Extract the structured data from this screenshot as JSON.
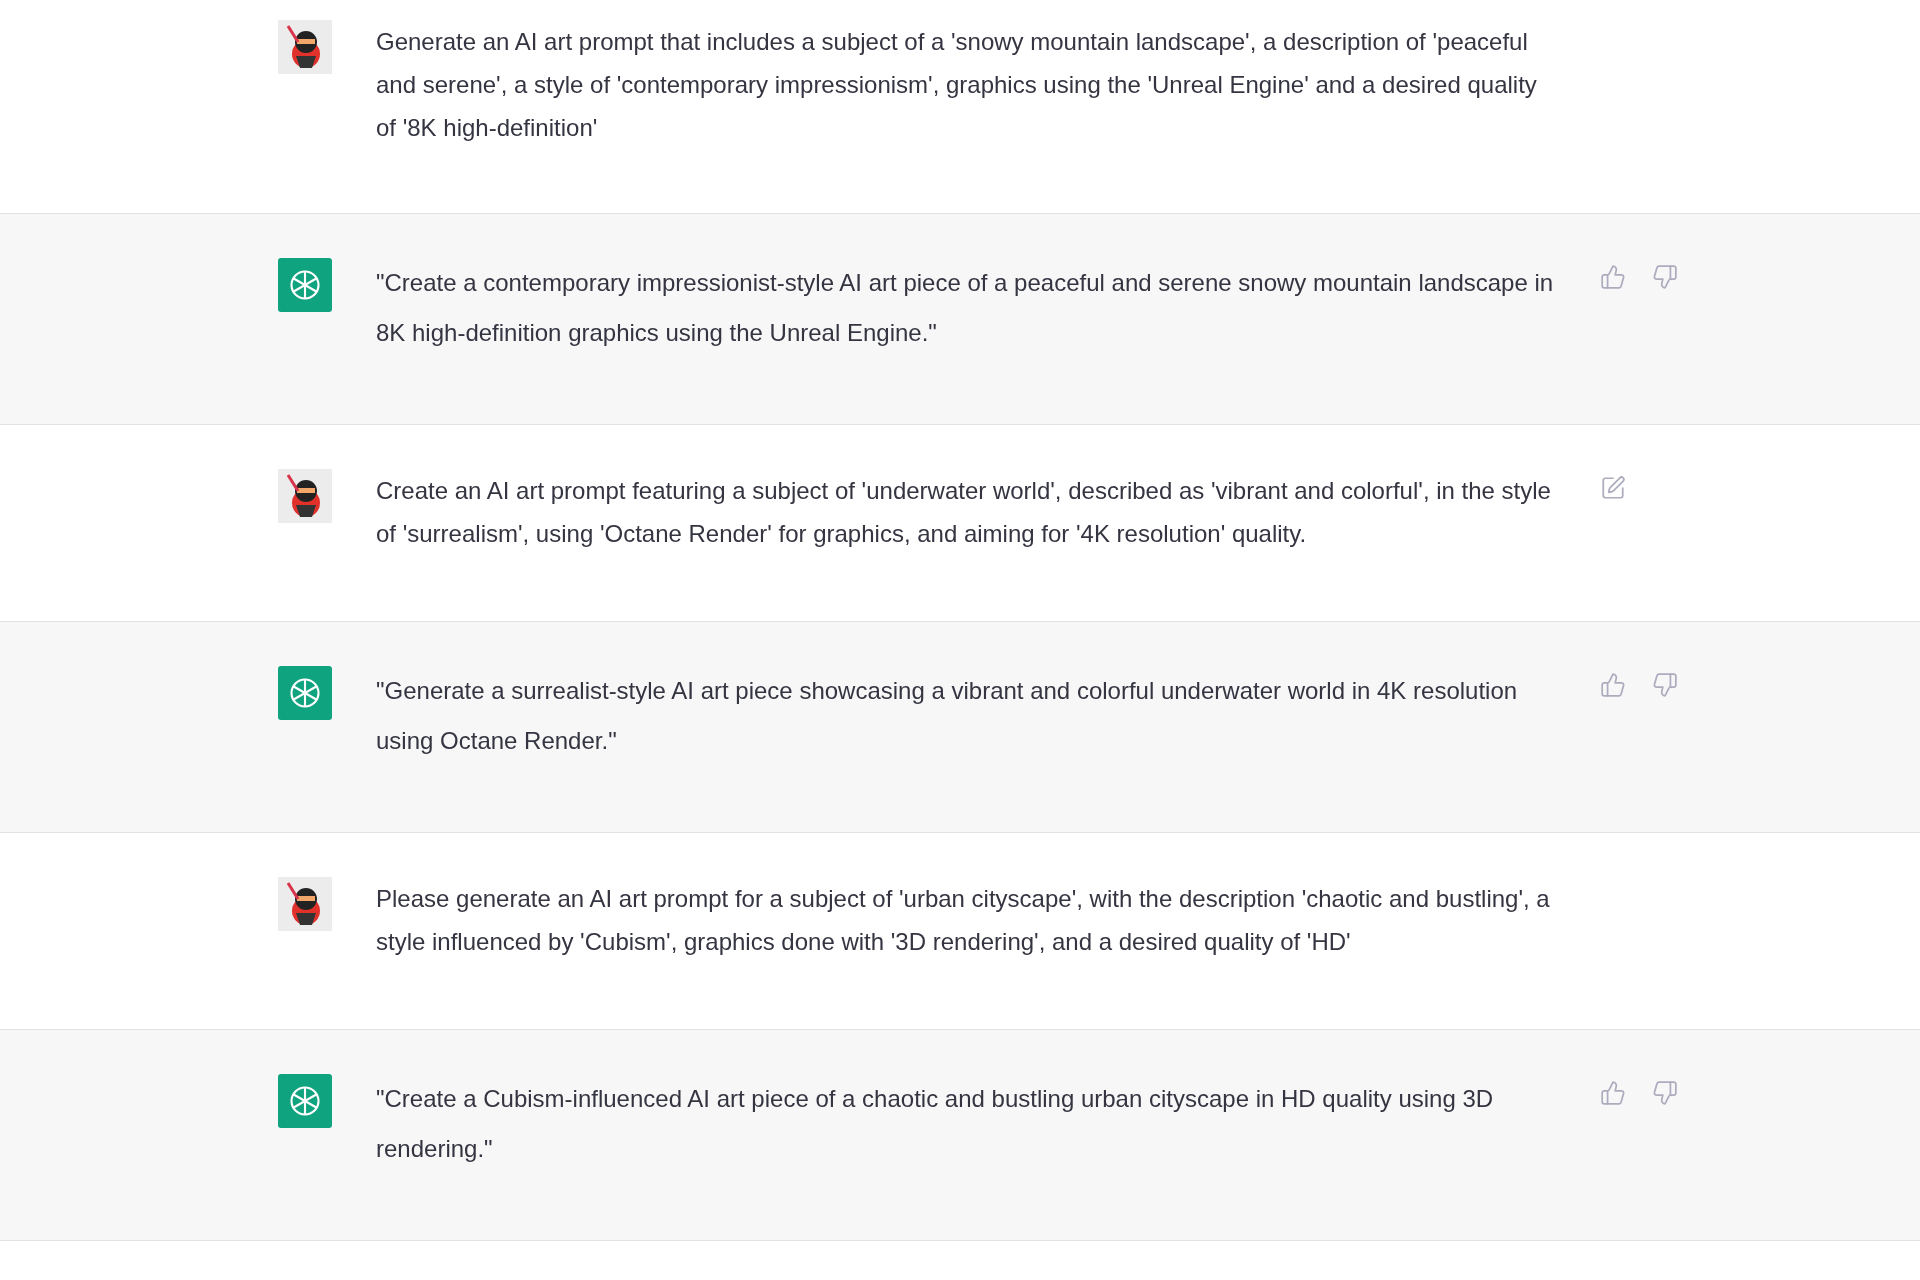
{
  "messages": [
    {
      "kind": "user",
      "edit_icon": false,
      "text": "Generate an AI art prompt that includes a subject of a 'snowy mountain landscape', a description of 'peaceful and serene', a style of 'contemporary impressionism', graphics using the 'Unreal Engine' and a desired quality of '8K high-definition'"
    },
    {
      "kind": "assistant",
      "text": "\"Create a contemporary impressionist-style AI art piece of a peaceful and serene snowy mountain landscape in 8K high-definition graphics using the Unreal Engine.\""
    },
    {
      "kind": "user",
      "edit_icon": true,
      "text": "Create an AI art prompt featuring a subject of 'underwater world', described as 'vibrant and colorful', in the style of 'surrealism', using 'Octane Render' for graphics, and aiming for '4K resolution' quality."
    },
    {
      "kind": "assistant",
      "text": "\"Generate a surrealist-style AI art piece showcasing a vibrant and colorful underwater world in 4K resolution using Octane Render.\""
    },
    {
      "kind": "user",
      "edit_icon": false,
      "text": "Please generate an AI art prompt for a subject of 'urban cityscape', with the description 'chaotic and bustling', a style influenced by 'Cubism', graphics done with '3D rendering', and a desired quality of 'HD'"
    },
    {
      "kind": "assistant",
      "text": "\"Create a Cubism-influenced AI art piece of a chaotic and bustling urban cityscape in HD quality using 3D rendering.\""
    }
  ]
}
